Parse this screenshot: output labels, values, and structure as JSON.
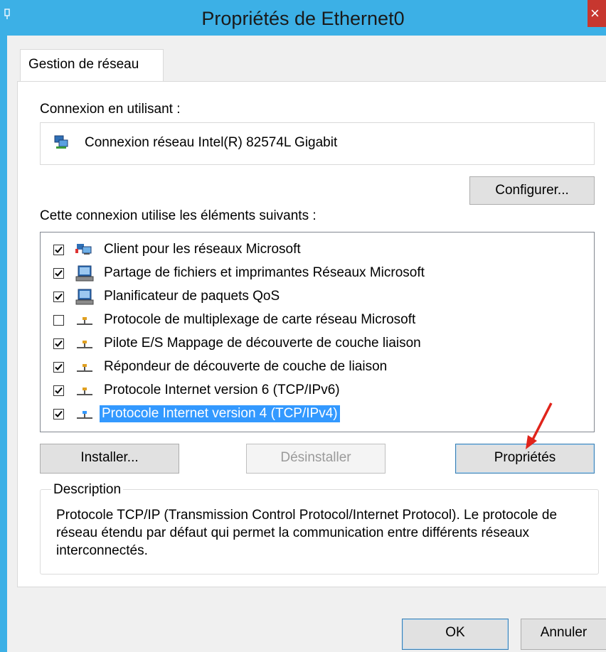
{
  "window": {
    "title": "Propriétés de Ethernet0"
  },
  "tabs": [
    {
      "label": "Gestion de réseau",
      "active": true
    }
  ],
  "connection": {
    "label": "Connexion en utilisant :",
    "adapter_name": "Connexion réseau Intel(R) 82574L Gigabit",
    "configure_label": "Configurer..."
  },
  "components": {
    "label": "Cette connexion utilise les éléments suivants :",
    "items": [
      {
        "label": "Client pour les réseaux Microsoft",
        "checked": true,
        "icon": "network-client-icon"
      },
      {
        "label": "Partage de fichiers et imprimantes Réseaux Microsoft",
        "checked": true,
        "icon": "computer-service-icon"
      },
      {
        "label": "Planificateur de paquets QoS",
        "checked": true,
        "icon": "computer-service-icon"
      },
      {
        "label": "Protocole de multiplexage de carte réseau Microsoft",
        "checked": false,
        "icon": "protocol-icon"
      },
      {
        "label": "Pilote E/S Mappage de découverte de couche liaison",
        "checked": true,
        "icon": "protocol-icon"
      },
      {
        "label": "Répondeur de découverte de couche de liaison",
        "checked": true,
        "icon": "protocol-icon"
      },
      {
        "label": "Protocole Internet version 6 (TCP/IPv6)",
        "checked": true,
        "icon": "protocol-icon"
      },
      {
        "label": "Protocole Internet version 4 (TCP/IPv4)",
        "checked": true,
        "icon": "protocol-icon",
        "selected": true
      }
    ]
  },
  "actions": {
    "install_label": "Installer...",
    "uninstall_label": "Désinstaller",
    "properties_label": "Propriétés"
  },
  "description": {
    "legend": "Description",
    "text": "Protocole TCP/IP (Transmission Control Protocol/Internet Protocol). Le protocole de réseau étendu par défaut qui permet la communication entre différents réseaux interconnectés."
  },
  "footer": {
    "ok_label": "OK",
    "cancel_label": "Annuler"
  },
  "colors": {
    "titlebar": "#3cb0e6",
    "selection": "#3399ff",
    "annotation_arrow": "#e0241b"
  }
}
